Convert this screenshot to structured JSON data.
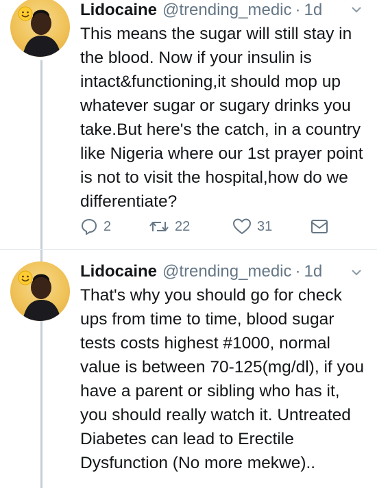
{
  "tweets": [
    {
      "name": "Lidocaine",
      "handle": "@trending_medic",
      "separator": "·",
      "time": "1d",
      "text": "This means the sugar will still stay in the blood. Now if your insulin is intact&functioning,it should mop up whatever sugar or sugary drinks you take.But here's the catch, in a country like Nigeria where our 1st prayer point is not to visit the hospital,how do we differentiate?",
      "replies": "2",
      "retweets": "22",
      "likes": "31"
    },
    {
      "name": "Lidocaine",
      "handle": "@trending_medic",
      "separator": "·",
      "time": "1d",
      "text": "That's why you should go for check ups from time to time, blood sugar tests costs highest #1000, normal value is between 70-125(mg/dl), if you have a parent or sibling who has it, you should really watch it. Untreated Diabetes can lead to Erectile Dysfunction (No more mekwe).."
    }
  ],
  "icons": {
    "reply": "reply-icon",
    "retweet": "retweet-icon",
    "like": "heart-icon",
    "dm": "envelope-icon",
    "caret": "chevron-down-icon",
    "badge": "smiley-emoji-icon"
  },
  "colors": {
    "text": "#14171a",
    "secondary": "#657786",
    "thread_line": "#c4cfd6"
  }
}
